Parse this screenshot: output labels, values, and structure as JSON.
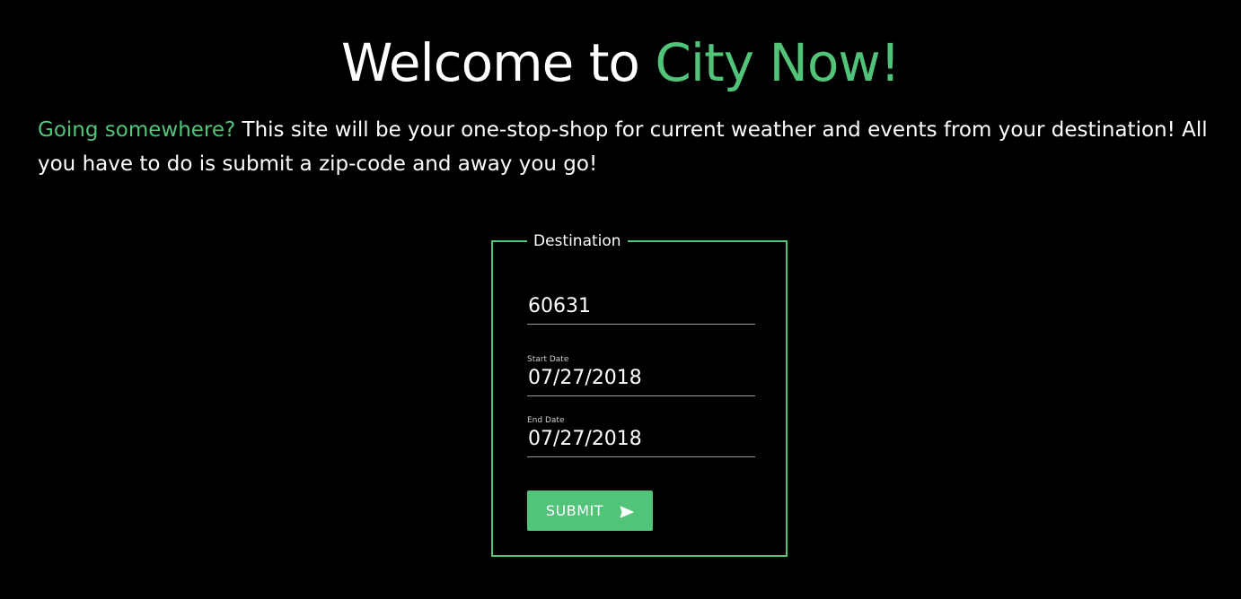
{
  "header": {
    "title_prefix": "Welcome to ",
    "title_accent": "City Now!"
  },
  "intro": {
    "accent": "Going somewhere?",
    "text": " This site will be your one-stop-shop for current weather and events from your destination! All you have to do is submit a zip-code and away you go!"
  },
  "form": {
    "legend": "Destination",
    "zip_value": "60631",
    "start_label": "Start Date",
    "start_value": "07/27/2018",
    "end_label": "End Date",
    "end_value": "07/27/2018",
    "submit_label": "SUBMIT",
    "submit_icon": "send-icon"
  },
  "colors": {
    "accent": "#52c47a",
    "background": "#000000",
    "text": "#ffffff"
  }
}
